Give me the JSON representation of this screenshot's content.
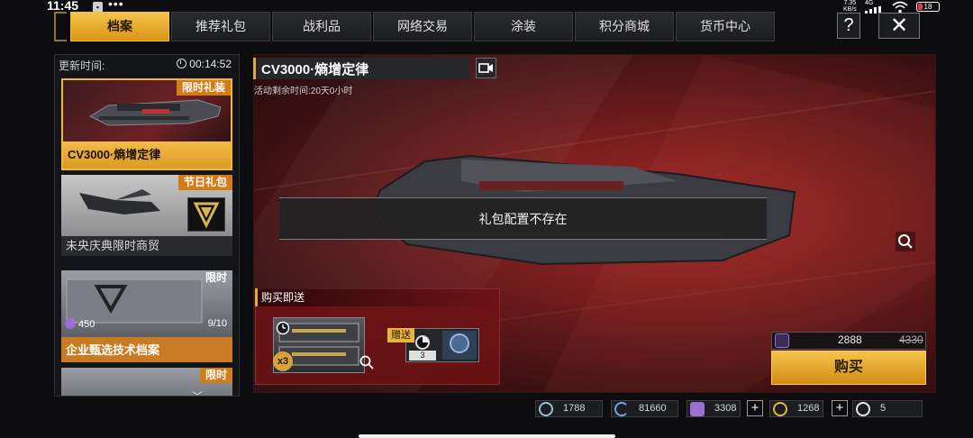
{
  "status_bar": {
    "time": "11:45",
    "dots": "•••",
    "net_speed_value": "7.35",
    "net_speed_unit": "KB/s",
    "network": "4G",
    "battery": "18",
    "notif_icon": "bag-icon"
  },
  "tabs": [
    {
      "label": "档案",
      "active": true
    },
    {
      "label": "推荐礼包",
      "active": false
    },
    {
      "label": "战利品",
      "active": false
    },
    {
      "label": "网络交易",
      "active": false
    },
    {
      "label": "涂装",
      "active": false
    },
    {
      "label": "积分商城",
      "active": false
    },
    {
      "label": "货币中心",
      "active": false
    }
  ],
  "header_buttons": {
    "help": "?",
    "close": "✕"
  },
  "sidebar": {
    "update_label": "更新时间:",
    "countdown": "00:14:52",
    "cards": [
      {
        "tag": "限时礼装",
        "name": "CV3000·熵增定律",
        "selected": true
      },
      {
        "tag": "节日礼包",
        "name": "未央庆典限时商贸"
      },
      {
        "tag": "限时",
        "name": "企业甄选技术档案",
        "price": "450",
        "stock": "9/10"
      },
      {
        "tag": "限时"
      }
    ]
  },
  "package": {
    "title": "CV3000·熵增定律",
    "remaining": "活动剩余时间:20天0小时",
    "toast": "礼包配置不存在"
  },
  "bonus": {
    "header": "购买即送",
    "crate_qty": "x3",
    "gift_label": "赠送",
    "gift_count": "3"
  },
  "purchase": {
    "price": "2888",
    "original_price": "4330",
    "buy_label": "购买"
  },
  "currencies": [
    {
      "icon": "gear-currency-icon",
      "value": "1788",
      "color": "#8ec3d4"
    },
    {
      "icon": "refresh-currency-icon",
      "value": "81660",
      "color": "#6aa8e8"
    },
    {
      "icon": "p-coin-icon",
      "value": "3308",
      "color": "#9b6fd6"
    },
    {
      "icon": "gold-coin-icon",
      "value": "1268",
      "color": "#e0b640"
    },
    {
      "icon": "pie-currency-icon",
      "value": "5",
      "color": "#e8e8e8"
    }
  ],
  "colors": {
    "accent": "#f2bc3f",
    "tag": "#d37d1a",
    "bg_red": "#a32a27"
  }
}
